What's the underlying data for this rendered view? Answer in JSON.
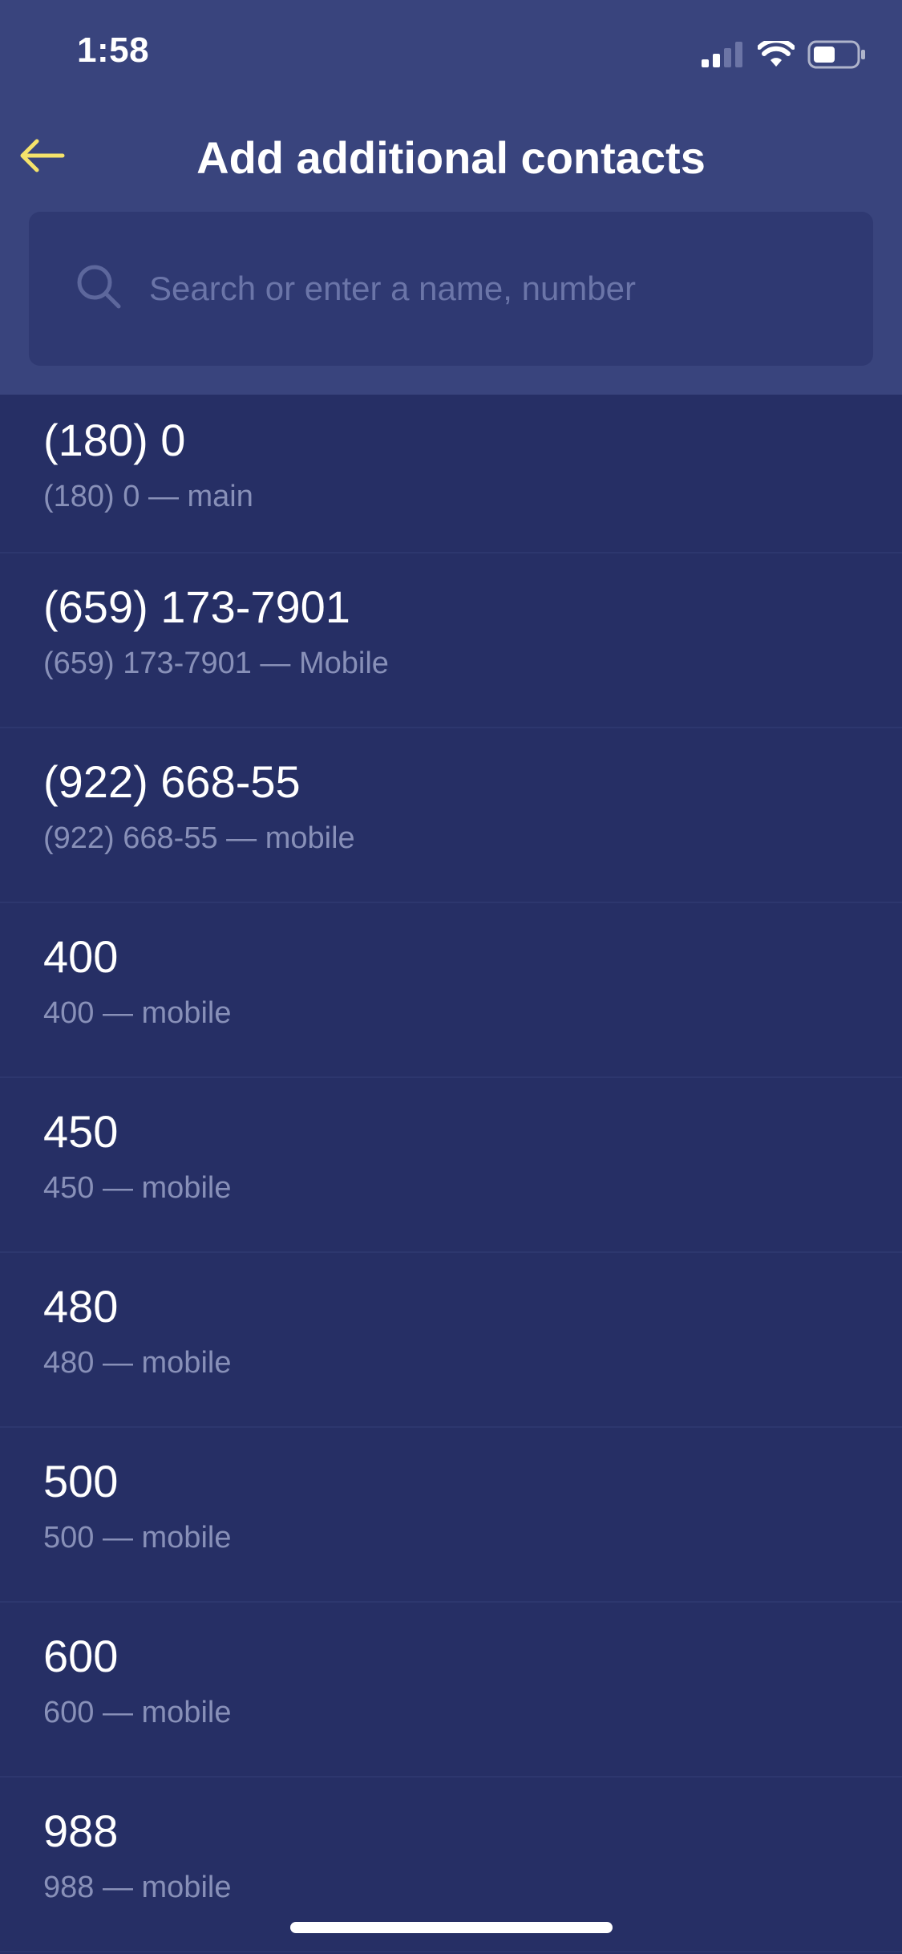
{
  "status_bar": {
    "time": "1:58",
    "icons": [
      "signal-icon",
      "wifi-icon",
      "battery-icon"
    ]
  },
  "header": {
    "title": "Add additional contacts",
    "back_icon": "arrow-left-icon",
    "accent_color": "#f5e36b"
  },
  "search": {
    "icon": "search-icon",
    "placeholder": "Search or enter a name, number",
    "value": ""
  },
  "contacts": [
    {
      "name": "(180) 0",
      "detail": "(180) 0 — main"
    },
    {
      "name": "(659) 173-7901",
      "detail": "(659) 173-7901 — Mobile"
    },
    {
      "name": "(922) 668-55",
      "detail": "(922) 668-55 — mobile"
    },
    {
      "name": "400",
      "detail": "400 — mobile"
    },
    {
      "name": "450",
      "detail": "450 — mobile"
    },
    {
      "name": "480",
      "detail": "480 — mobile"
    },
    {
      "name": "500",
      "detail": "500 — mobile"
    },
    {
      "name": "600",
      "detail": "600 — mobile"
    },
    {
      "name": "988",
      "detail": "988 — mobile"
    }
  ],
  "colors": {
    "header_background": "#39447d",
    "list_background": "#262f65",
    "search_background": "#2f3972",
    "secondary_text": "#8890b8"
  }
}
